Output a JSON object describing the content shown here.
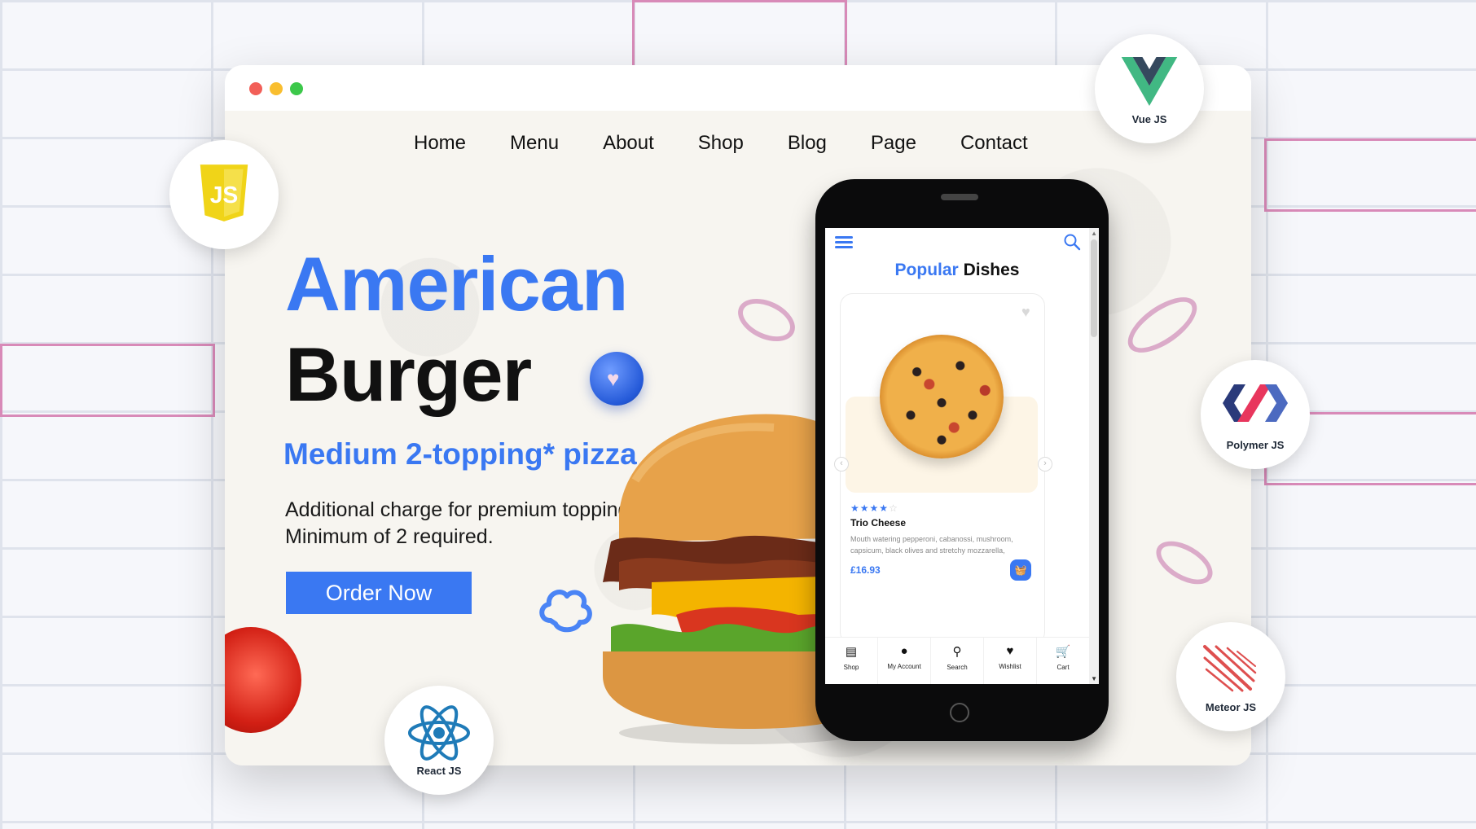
{
  "window": {
    "controls": [
      "close",
      "minimize",
      "maximize"
    ]
  },
  "nav": {
    "items": [
      "Home",
      "Menu",
      "About",
      "Shop",
      "Blog",
      "Page",
      "Contact"
    ]
  },
  "hero": {
    "title_line1": "American",
    "title_line2": "Burger",
    "subtitle": "Medium 2-topping* pizza",
    "description_line1": "Additional charge for premium toppings.",
    "description_line2": "Minimum of 2 required.",
    "cta_label": "Order Now"
  },
  "phone": {
    "heading_accent": "Popular",
    "heading_rest": "Dishes",
    "dish": {
      "name": "Trio Cheese",
      "rating": 4,
      "rating_max": 5,
      "description": "Mouth watering pepperoni, cabanossi, mushroom, capsicum, black olives and stretchy mozzarella,",
      "price": "£16.93"
    },
    "tabs": [
      {
        "label": "Shop",
        "icon": "store-icon"
      },
      {
        "label": "My Account",
        "icon": "user-icon"
      },
      {
        "label": "Search",
        "icon": "search-icon"
      },
      {
        "label": "Wishlist",
        "icon": "heart-icon"
      },
      {
        "label": "Cart",
        "icon": "cart-icon"
      }
    ]
  },
  "badges": {
    "js": "",
    "vue": "Vue JS",
    "polymer": "Polymer JS",
    "meteor": "Meteor JS",
    "react": "React JS"
  },
  "colors": {
    "accent": "#3a78f2",
    "vue_green": "#41b883",
    "vue_dark": "#35495e",
    "js_yellow": "#f0d418",
    "react_blue": "#1f7bb8",
    "polymer_navy": "#2a3a7a",
    "polymer_red": "#e8365d",
    "meteor_red": "#de4f4f"
  }
}
